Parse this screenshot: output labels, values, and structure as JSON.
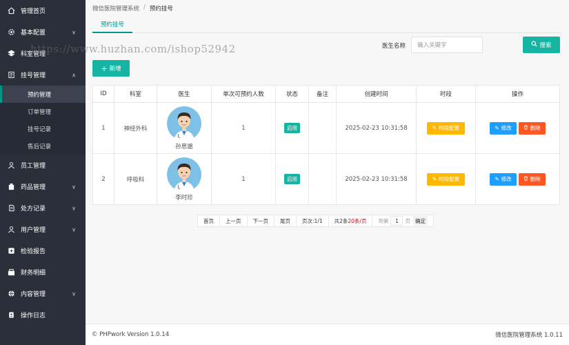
{
  "sidebar": {
    "items": [
      {
        "label": "管理首页",
        "icon": "home-icon"
      },
      {
        "label": "基本配置",
        "icon": "gear-icon",
        "expandable": true
      },
      {
        "label": "科室管理",
        "icon": "building-icon"
      },
      {
        "label": "挂号管理",
        "icon": "list-icon",
        "expanded": true
      },
      {
        "label": "员工管理",
        "icon": "user-icon"
      },
      {
        "label": "药品管理",
        "icon": "medicine-icon",
        "expandable": true
      },
      {
        "label": "处方记录",
        "icon": "document-icon",
        "expandable": true
      },
      {
        "label": "用户管理",
        "icon": "user-icon",
        "expandable": true
      },
      {
        "label": "检验报告",
        "icon": "report-icon"
      },
      {
        "label": "财务明细",
        "icon": "finance-icon"
      },
      {
        "label": "内容管理",
        "icon": "globe-icon",
        "expandable": true
      },
      {
        "label": "操作日志",
        "icon": "log-icon"
      }
    ],
    "sub_items": [
      {
        "label": "预约管理",
        "active": true
      },
      {
        "label": "订单管理"
      },
      {
        "label": "挂号记录"
      },
      {
        "label": "售后记录"
      }
    ]
  },
  "breadcrumb": {
    "root": "微信医院管理系统",
    "sep": "/",
    "current": "预约挂号"
  },
  "tab": {
    "label": "预约挂号"
  },
  "search": {
    "label": "医生名称",
    "placeholder": "输入关键字",
    "button": "搜索"
  },
  "add_button": "新增",
  "table": {
    "headers": [
      "ID",
      "科室",
      "医生",
      "单次可预约人数",
      "状态",
      "备注",
      "创建时间",
      "时段",
      "操作"
    ],
    "rows": [
      {
        "id": "1",
        "dept": "神经外科",
        "doctor": "孙思邈",
        "quota": "1",
        "status": "启用",
        "note": "",
        "created": "2025-02-23 10:31:58",
        "slot_btn": "时段配置",
        "edit": "修改",
        "delete": "删除"
      },
      {
        "id": "2",
        "dept": "呼吸科",
        "doctor": "李时珍",
        "quota": "1",
        "status": "启用",
        "note": "",
        "created": "2025-02-23 10:31:58",
        "slot_btn": "时段配置",
        "edit": "修改",
        "delete": "删除"
      }
    ]
  },
  "pager": {
    "first": "首页",
    "prev": "上一页",
    "next": "下一页",
    "last": "尾页",
    "page_info": "页次:1/1",
    "total_prefix": "共2条",
    "per_page": "20条/页",
    "goto": "到第",
    "page_value": "1",
    "page_unit": "页",
    "confirm": "确定"
  },
  "footer": {
    "left": "© PHPwork Version 1.0.14",
    "right": "微信医院管理系统 1.0.11"
  },
  "watermark": "https://www.huzhan.com/ishop52942",
  "colors": {
    "sidebar": "#2b2f3a",
    "accent": "#009688",
    "primary_btn": "#16b4a2",
    "warn": "#ffb800",
    "info": "#1e9fff",
    "danger": "#ff5722"
  }
}
